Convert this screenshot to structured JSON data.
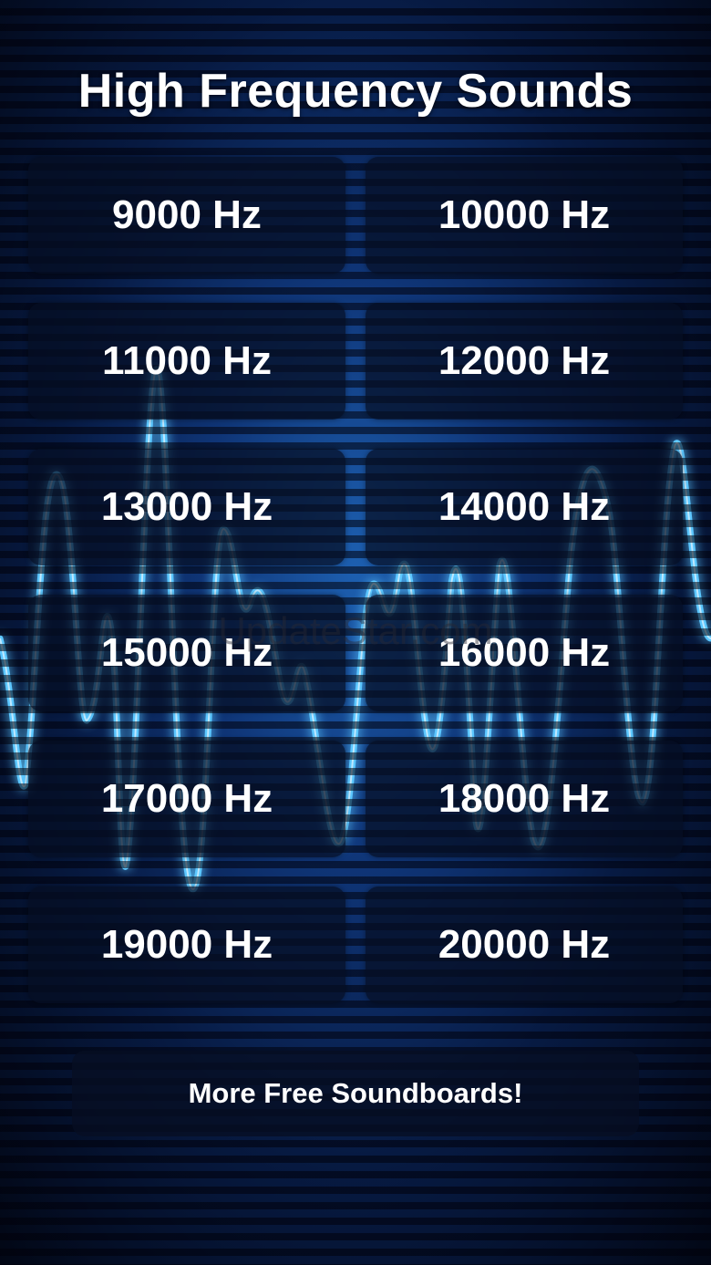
{
  "title": "High Frequency Sounds",
  "buttons": [
    {
      "label": "9000 Hz"
    },
    {
      "label": "10000 Hz"
    },
    {
      "label": "11000 Hz"
    },
    {
      "label": "12000 Hz"
    },
    {
      "label": "13000 Hz"
    },
    {
      "label": "14000 Hz"
    },
    {
      "label": "15000 Hz"
    },
    {
      "label": "16000 Hz"
    },
    {
      "label": "17000 Hz"
    },
    {
      "label": "18000 Hz"
    },
    {
      "label": "19000 Hz"
    },
    {
      "label": "20000 Hz"
    }
  ],
  "more_button": {
    "label": "More Free Soundboards!"
  },
  "watermark": "UpdateStar.com",
  "colors": {
    "background": "#03091c",
    "wave": "#5cc7ff",
    "button_bg": "#060e22",
    "text": "#ffffff"
  }
}
